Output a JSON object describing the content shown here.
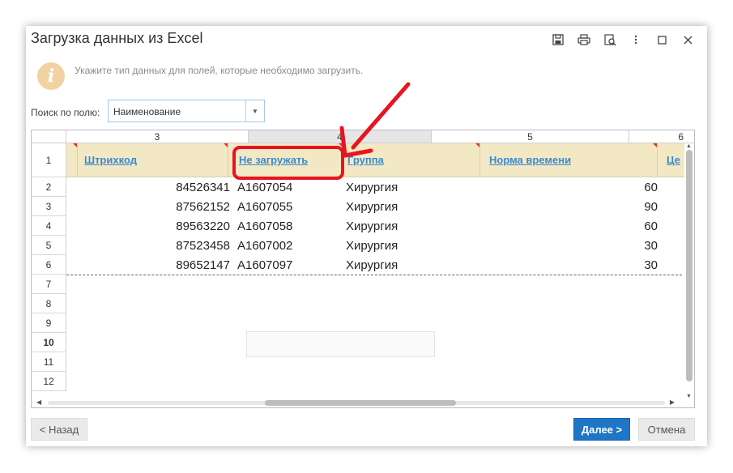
{
  "window": {
    "title": "Загрузка данных из Excel",
    "title_icons": [
      "save-icon",
      "print-icon",
      "preview-icon",
      "more-icon",
      "maximize-icon",
      "close-icon"
    ]
  },
  "info": {
    "icon_glyph": "i",
    "text": "Укажите тип данных для полей, которые необходимо загрузить."
  },
  "search": {
    "label": "Поиск по полю:",
    "value": "Наименование"
  },
  "grid": {
    "column_numbers": [
      "3",
      "4",
      "5",
      "6"
    ],
    "row_numbers": [
      "1",
      "2",
      "3",
      "4",
      "5",
      "6",
      "7",
      "8",
      "9",
      "10",
      "11",
      "12"
    ],
    "headers": [
      "Штрихкод",
      "Не загружать",
      "Группа",
      "Норма времени",
      "Це"
    ],
    "rows": [
      [
        "84526341",
        "A1607054",
        "Хирургия",
        "60"
      ],
      [
        "87562152",
        "A1607055",
        "Хирургия",
        "90"
      ],
      [
        "89563220",
        "A1607058",
        "Хирургия",
        "60"
      ],
      [
        "87523458",
        "A1607002",
        "Хирургия",
        "30"
      ],
      [
        "89652147",
        "A1607097",
        "Хирургия",
        "30"
      ]
    ]
  },
  "buttons": {
    "back": "< Назад",
    "next": "Далее >",
    "cancel": "Отмена"
  },
  "colors": {
    "highlight": "#e8141f",
    "accent": "#1f75c6",
    "header_band": "#f3e8c4",
    "link": "#3a8ad0"
  }
}
